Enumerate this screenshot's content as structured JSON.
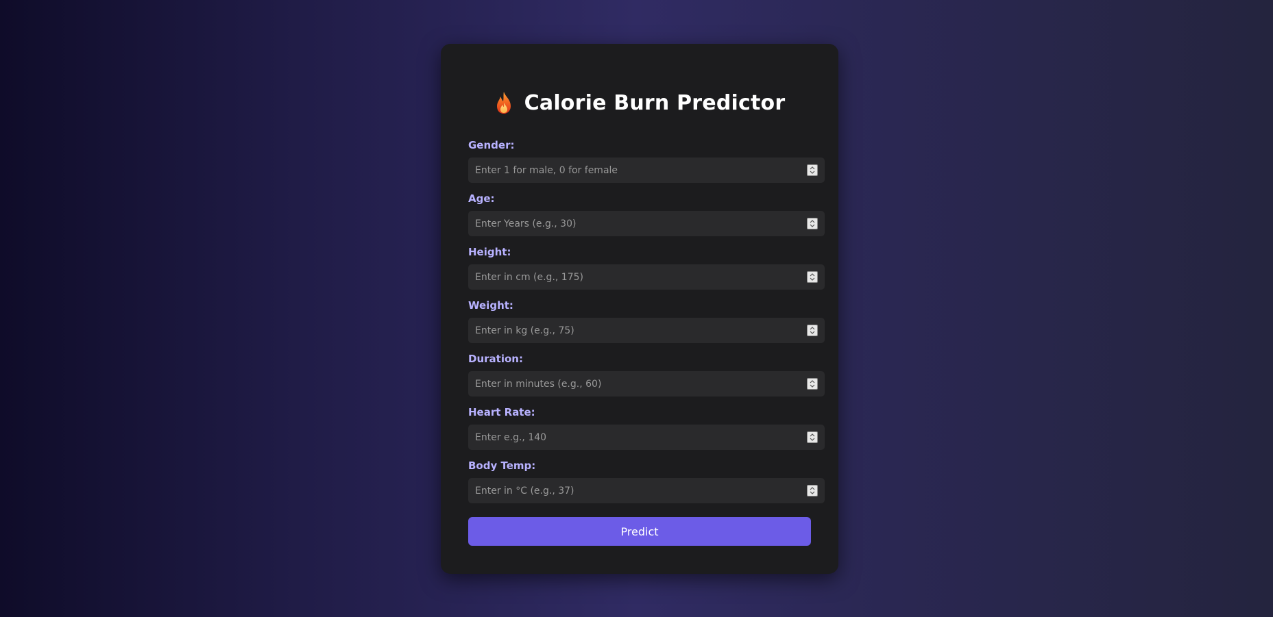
{
  "app": {
    "title": "Calorie Burn Predictor",
    "title_icon": "flame-icon"
  },
  "fields": [
    {
      "label": "Gender:",
      "placeholder": "Enter 1 for male, 0 for female",
      "value": ""
    },
    {
      "label": "Age:",
      "placeholder": "Enter Years (e.g., 30)",
      "value": ""
    },
    {
      "label": "Height:",
      "placeholder": "Enter in cm (e.g., 175)",
      "value": ""
    },
    {
      "label": "Weight:",
      "placeholder": "Enter in kg (e.g., 75)",
      "value": ""
    },
    {
      "label": "Duration:",
      "placeholder": "Enter in minutes (e.g., 60)",
      "value": ""
    },
    {
      "label": "Heart Rate:",
      "placeholder": "Enter e.g., 140",
      "value": ""
    },
    {
      "label": "Body Temp:",
      "placeholder": "Enter in °C (e.g., 37)",
      "value": ""
    }
  ],
  "actions": {
    "predict_label": "Predict"
  },
  "colors": {
    "accent": "#6c5ce7",
    "label": "#b8b2ff",
    "card": "#1c1c1e",
    "input_bg": "#2a2a2c"
  }
}
